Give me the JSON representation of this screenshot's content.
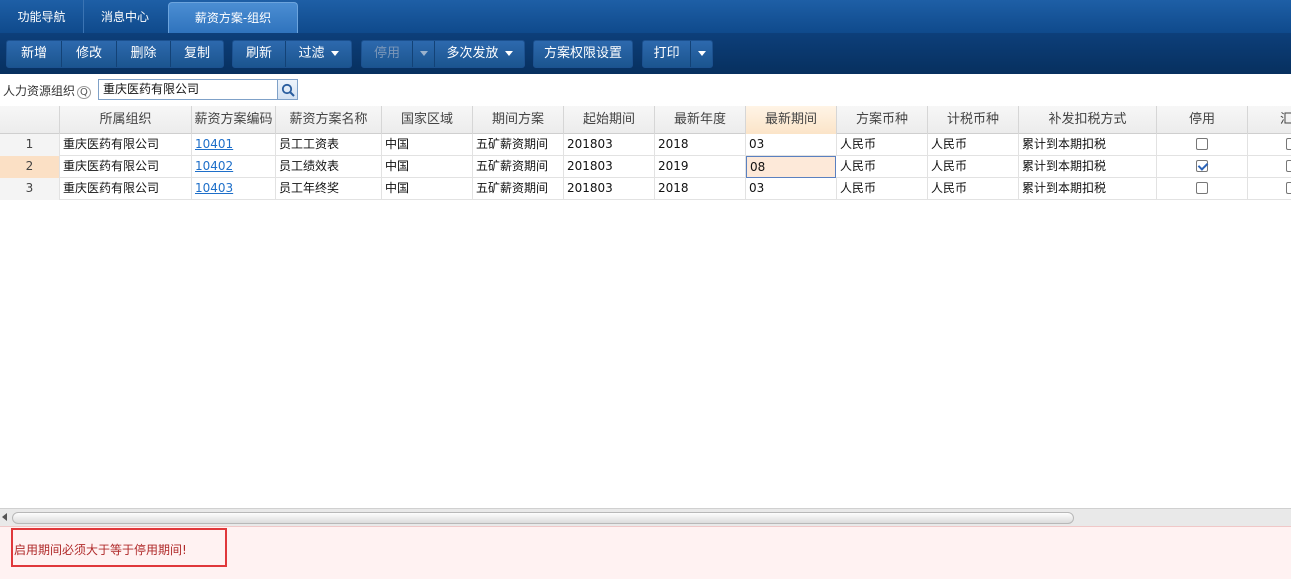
{
  "tabs": [
    {
      "label": "功能导航"
    },
    {
      "label": "消息中心"
    },
    {
      "label": "薪资方案-组织"
    }
  ],
  "toolbar": {
    "new": "新增",
    "edit": "修改",
    "delete": "删除",
    "copy": "复制",
    "refresh": "刷新",
    "filter": "过滤",
    "disable": "停用",
    "multi_issue": "多次发放",
    "permission": "方案权限设置",
    "print": "打印"
  },
  "org": {
    "label": "人力资源组织",
    "value": "重庆医药有限公司"
  },
  "columns": [
    "所属组织",
    "薪资方案编码",
    "薪资方案名称",
    "国家区域",
    "期间方案",
    "起始期间",
    "最新年度",
    "最新期间",
    "方案币种",
    "计税币种",
    "补发扣税方式",
    "停用",
    "汇总"
  ],
  "rows": [
    {
      "num": "1",
      "org": "重庆医药有限公司",
      "code": "10401",
      "name": "员工工资表",
      "region": "中国",
      "period_scheme": "五矿薪资期间",
      "start": "201803",
      "year": "2018",
      "period": "03",
      "currency": "人民币",
      "tax_currency": "人民币",
      "tax_method": "累计到本期扣税",
      "disabled": false
    },
    {
      "num": "2",
      "org": "重庆医药有限公司",
      "code": "10402",
      "name": "员工绩效表",
      "region": "中国",
      "period_scheme": "五矿薪资期间",
      "start": "201803",
      "year": "2019",
      "period": "08",
      "currency": "人民币",
      "tax_currency": "人民币",
      "tax_method": "累计到本期扣税",
      "disabled": true
    },
    {
      "num": "3",
      "org": "重庆医药有限公司",
      "code": "10403",
      "name": "员工年终奖",
      "region": "中国",
      "period_scheme": "五矿薪资期间",
      "start": "201803",
      "year": "2018",
      "period": "03",
      "currency": "人民币",
      "tax_currency": "人民币",
      "tax_method": "累计到本期扣税",
      "disabled": false
    }
  ],
  "error": {
    "message": "启用期间必须大于等于停用期间!"
  },
  "colors": {
    "nav_dark": "#07305f",
    "accent_link": "#1e6fc9",
    "error_border": "#e0383b",
    "error_text": "#b02a2a"
  }
}
